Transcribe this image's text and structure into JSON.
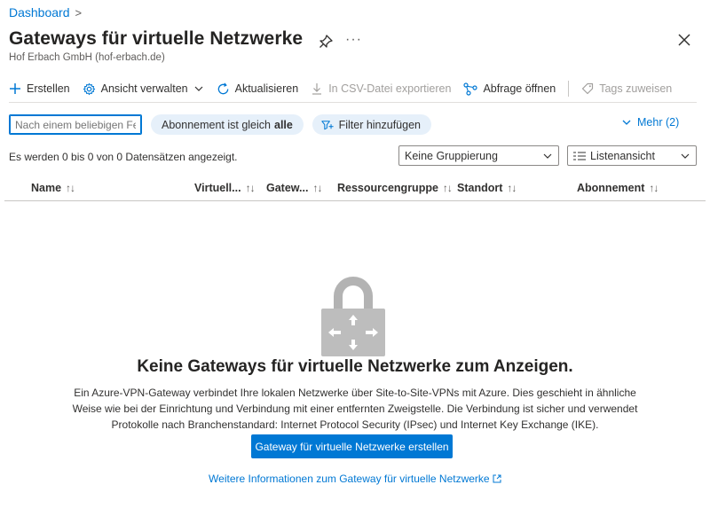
{
  "breadcrumb": {
    "item": "Dashboard",
    "separator": ">"
  },
  "header": {
    "title": "Gateways für virtuelle Netzwerke",
    "subtitle": "Hof Erbach GmbH (hof-erbach.de)",
    "more_label": "···"
  },
  "toolbar": {
    "create": "Erstellen",
    "manage_view": "Ansicht verwalten",
    "refresh": "Aktualisieren",
    "export_csv": "In CSV-Datei exportieren",
    "open_query": "Abfrage öffnen",
    "assign_tags": "Tags zuweisen"
  },
  "filters": {
    "search_placeholder": "Nach einem beliebigen Feld filtern...",
    "subscription_prefix": "Abonnement ist gleich",
    "subscription_value": "alle",
    "add_filter": "Filter hinzufügen",
    "more": "Mehr (2)"
  },
  "records": {
    "count_text": "Es werden 0 bis 0 von 0 Datensätzen angezeigt.",
    "grouping": "Keine Gruppierung",
    "view": "Listenansicht"
  },
  "table": {
    "columns": [
      "Name",
      "Virtuell...",
      "Gatew...",
      "Ressourcengruppe",
      "Standort",
      "Abonnement"
    ]
  },
  "empty_state": {
    "title": "Keine Gateways für virtuelle Netzwerke zum Anzeigen.",
    "description": "Ein Azure-VPN-Gateway verbindet Ihre lokalen Netzwerke über Site-to-Site-VPNs mit Azure. Dies geschieht in ähnliche Weise wie bei der Einrichtung und Verbindung mit einer entfernten Zweigstelle. Die Verbindung ist sicher und verwendet Protokolle nach Branchenstandard: Internet Protocol Security (IPsec) und Internet Key Exchange (IKE).",
    "button": "Gateway für virtuelle Netzwerke erstellen",
    "link": "Weitere Informationen zum Gateway für virtuelle Netzwerke"
  },
  "colors": {
    "accent": "#0078d4",
    "pill_bg": "#e6f0fa",
    "text": "#323130",
    "disabled": "#a19f9d"
  }
}
